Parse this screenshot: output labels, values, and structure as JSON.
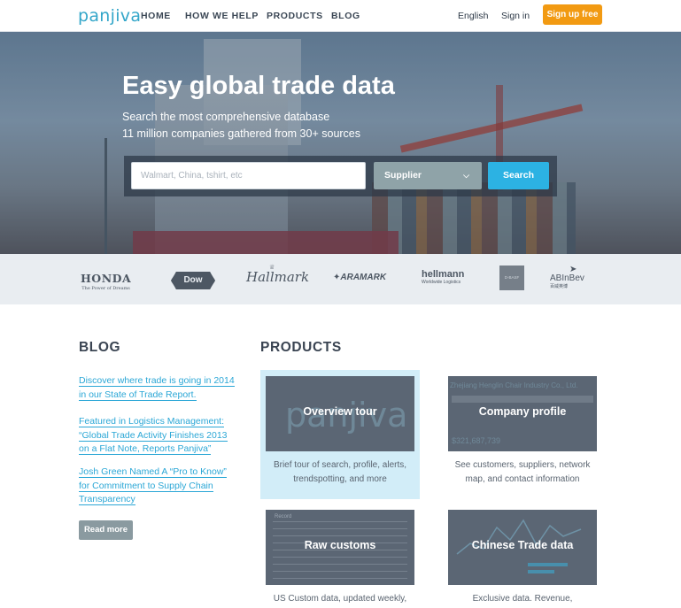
{
  "nav": {
    "logo": "panjiva",
    "links": [
      "HOME",
      "HOW WE HELP",
      "PRODUCTS",
      "BLOG"
    ],
    "language": "English",
    "signin": "Sign in",
    "signup": "Sign up free"
  },
  "hero": {
    "title": "Easy global trade data",
    "subtitle_1": "Search the most comprehensive database",
    "subtitle_2": "11 million companies gathered from 30+ sources",
    "search_placeholder": "Walmart, China, tshirt, etc",
    "search_type": "Supplier",
    "search_button": "Search"
  },
  "customer_logos": {
    "honda": "HONDA",
    "honda_tagline": "The Power of Dreams",
    "dow": "Dow",
    "hallmark": "Hallmark",
    "aramark": "ARAMARK",
    "hellmann": "hellmann",
    "hellmann_tagline": "Worldwide Logistics",
    "basf": "D-BASF",
    "abinbev": "ABInBev",
    "abinbev_sub": "百威英博"
  },
  "blog": {
    "title": "BLOG",
    "posts": [
      "Discover where trade is going in 2014 in our State of Trade Report.",
      "Featured in Logistics Management: “Global Trade Activity Finishes 2013 on a Flat Note, Reports Panjiva”",
      "Josh Green Named A “Pro to Know” for Commitment to Supply Chain Transparency"
    ],
    "read_more": "Read more"
  },
  "products": {
    "title": "PRODUCTS",
    "items": [
      {
        "name": "Overview tour",
        "desc_1": "Brief tour of search, profile, alerts,",
        "desc_2": "trendspotting, and more",
        "bg_text": "panjiva"
      },
      {
        "name": "Company profile",
        "desc_1": "See customers, suppliers, network",
        "desc_2": "map, and contact information",
        "bg_text": "Zhejiang Henglin Chair Industry Co., Ltd.",
        "bg_value": "$321,687,739"
      },
      {
        "name": "Raw customs",
        "desc_1": "US Custom data, updated weekly,",
        "desc_2": "",
        "bg_text": "Record"
      },
      {
        "name": "Chinese Trade data",
        "desc_1": "Exclusive data. Revenue,",
        "desc_2": ""
      }
    ]
  },
  "colors": {
    "accent": "#2cb2e3",
    "signup": "#f29a12",
    "logo": "#33a6c9",
    "highlight_card": "#d2edf8"
  }
}
